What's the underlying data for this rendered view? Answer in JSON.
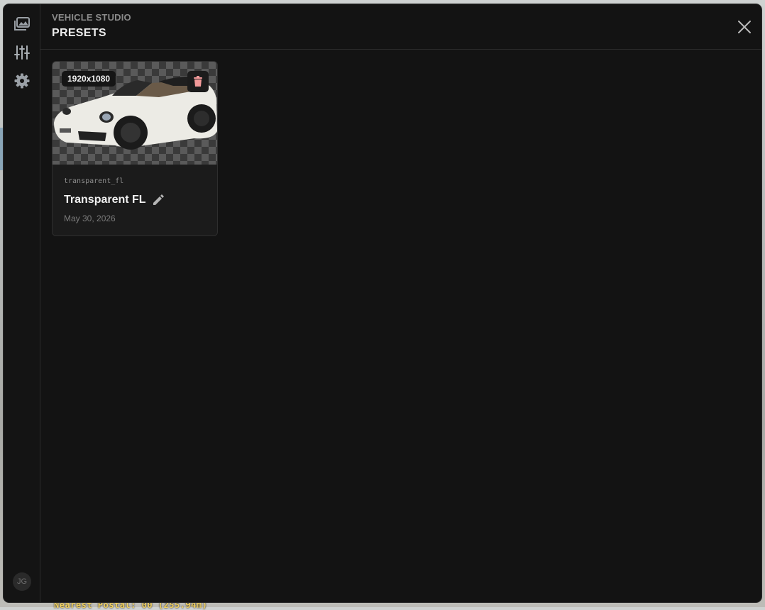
{
  "app": {
    "eyebrow": "VEHICLE STUDIO",
    "title": "PRESETS",
    "accent_color": "#f39a9a",
    "background_color": "#131313"
  },
  "sidebar": {
    "items": [
      {
        "icon": "gallery-icon",
        "label": "Gallery"
      },
      {
        "icon": "sliders-icon",
        "label": "Presets"
      },
      {
        "icon": "gear-icon",
        "label": "Settings"
      }
    ],
    "avatar_initials": "JG"
  },
  "header": {
    "close_icon": "close-icon"
  },
  "presets": [
    {
      "resolution": "1920x1080",
      "id": "transparent_fl",
      "name": "Transparent FL",
      "date": "May 30, 2026",
      "thumbnail": "white convertible sports car on transparent checkerboard",
      "delete_icon": "trash-icon",
      "edit_icon": "pencil-icon"
    }
  ],
  "background": {
    "hud_text": "Nearest Postal: 00 (255.94m)"
  }
}
